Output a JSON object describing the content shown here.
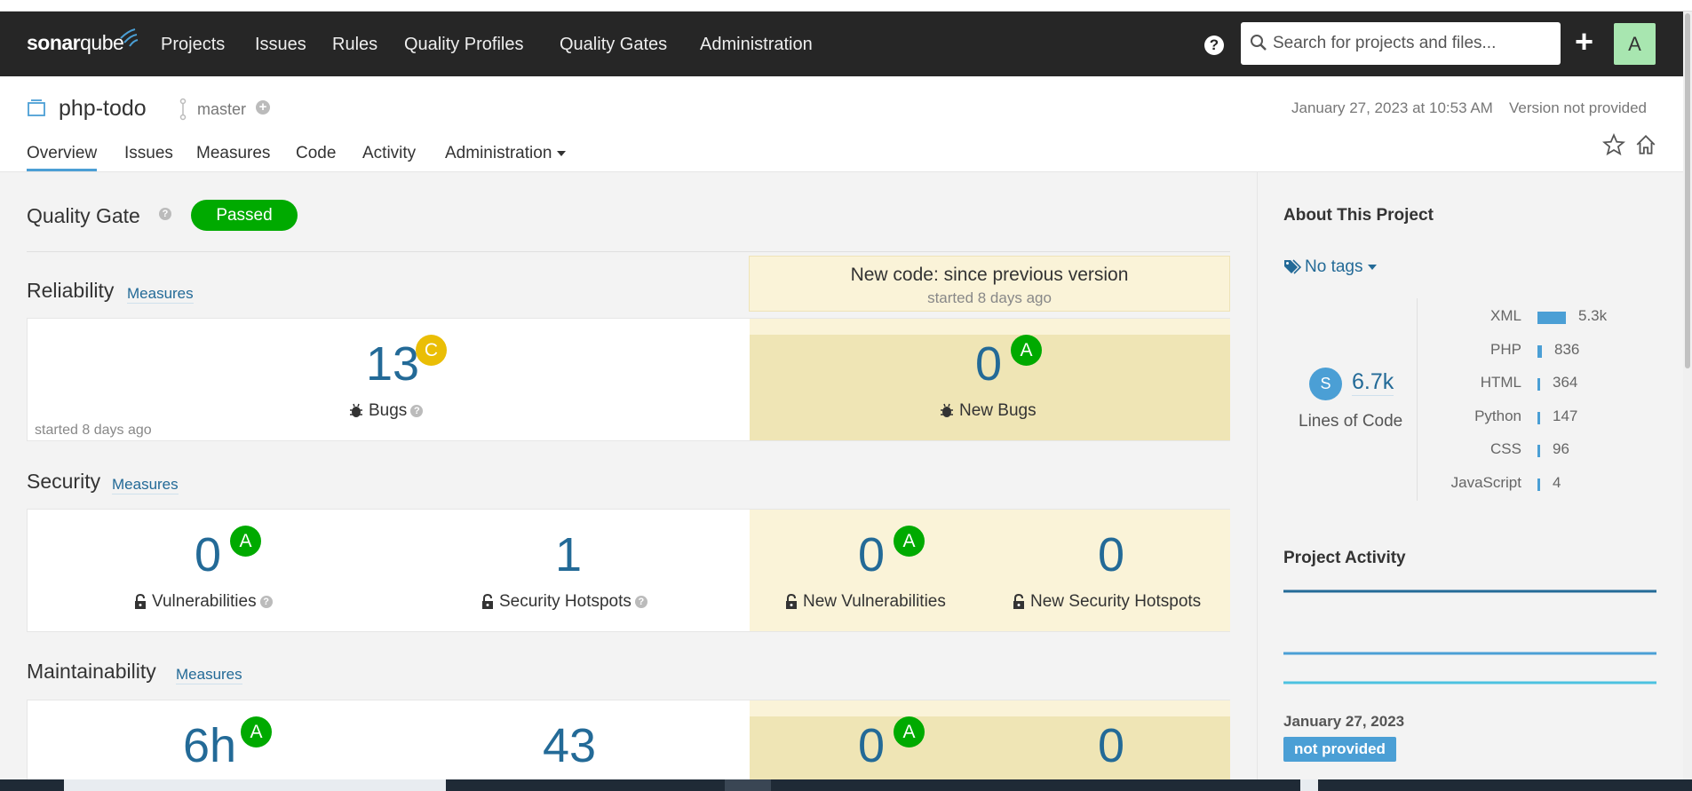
{
  "nav": {
    "logo_sonar": "sonar",
    "logo_qube": "qube",
    "items": [
      "Projects",
      "Issues",
      "Rules",
      "Quality Profiles",
      "Quality Gates",
      "Administration"
    ],
    "help_label": "?",
    "search_placeholder": "Search for projects and files...",
    "plus_label": "+",
    "avatar_letter": "A"
  },
  "project": {
    "name": "php-todo",
    "branch": "master",
    "branch_add": "+",
    "date": "January 27, 2023 at 10:53 AM",
    "version": "Version not provided",
    "tabs": [
      "Overview",
      "Issues",
      "Measures",
      "Code",
      "Activity",
      "Administration"
    ]
  },
  "quality_gate": {
    "title": "Quality Gate",
    "status": "Passed"
  },
  "new_code": {
    "title": "New code: since previous version",
    "subtitle": "started 8 days ago"
  },
  "reliability": {
    "title": "Reliability",
    "link": "Measures",
    "bugs_value": "13",
    "bugs_rating": "C",
    "bugs_label": "Bugs",
    "note": "started 8 days ago",
    "new_bugs_value": "0",
    "new_bugs_rating": "A",
    "new_bugs_label": "New Bugs"
  },
  "security": {
    "title": "Security",
    "link": "Measures",
    "vuln_value": "0",
    "vuln_rating": "A",
    "vuln_label": "Vulnerabilities",
    "hotspots_value": "1",
    "hotspots_label": "Security Hotspots",
    "new_vuln_value": "0",
    "new_vuln_rating": "A",
    "new_vuln_label": "New Vulnerabilities",
    "new_hotspots_value": "0",
    "new_hotspots_label": "New Security Hotspots"
  },
  "maintainability": {
    "title": "Maintainability",
    "link": "Measures",
    "debt_value": "6h",
    "debt_rating": "A",
    "smells_value": "43",
    "new_debt_value": "0",
    "new_debt_rating": "A",
    "new_smells_value": "0"
  },
  "sidebar": {
    "about_title": "About This Project",
    "tags": "No tags",
    "loc_size": "S",
    "loc_value": "6.7k",
    "loc_label": "Lines of Code",
    "languages": [
      {
        "name": "XML",
        "value": "5.3k",
        "share": 1.0
      },
      {
        "name": "PHP",
        "value": "836",
        "share": 0.16
      },
      {
        "name": "HTML",
        "value": "364",
        "share": 0.07
      },
      {
        "name": "Python",
        "value": "147",
        "share": 0.03
      },
      {
        "name": "CSS",
        "value": "96",
        "share": 0.02
      },
      {
        "name": "JavaScript",
        "value": "4",
        "share": 0.01
      }
    ],
    "activity_title": "Project Activity",
    "activity_date": "January 27, 2023",
    "activity_badge": "not provided"
  },
  "colors": {
    "rating_A": "#00aa00",
    "rating_C": "#eabe06",
    "link": "#236a97",
    "new_code_bg": "#faf3d8"
  }
}
